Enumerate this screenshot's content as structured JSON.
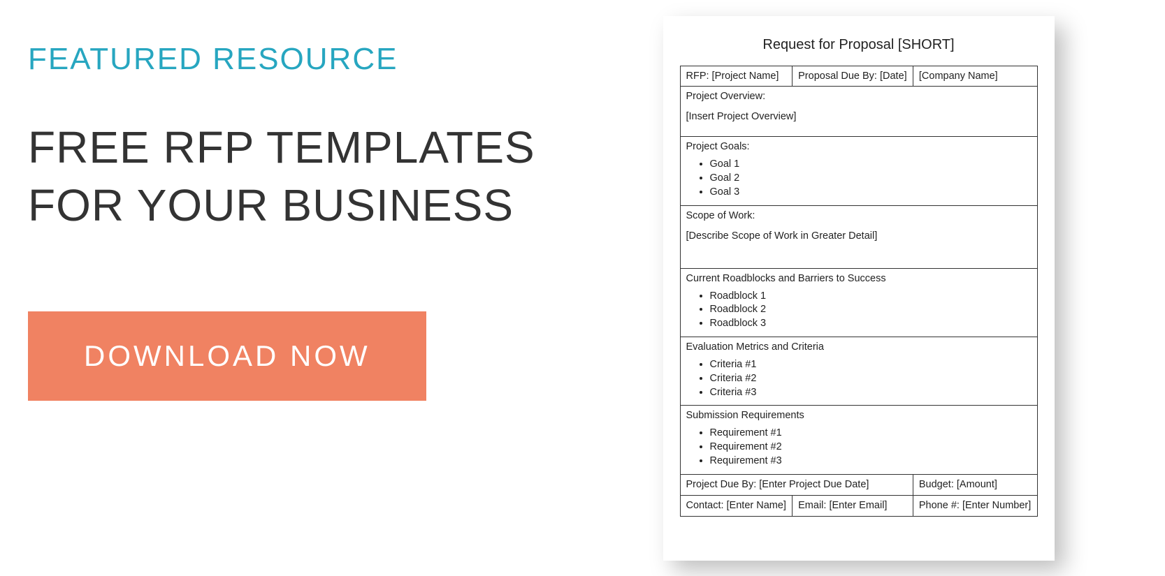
{
  "left": {
    "eyebrow": "FEATURED RESOURCE",
    "headline": "FREE RFP TEMPLATES FOR YOUR BUSINESS",
    "cta": "DOWNLOAD NOW"
  },
  "doc": {
    "title": "Request for Proposal [SHORT]",
    "row1": {
      "rfp": "RFP: [Project Name]",
      "due": "Proposal Due By: [Date]",
      "company": "[Company Name]"
    },
    "overview": {
      "label": "Project Overview:",
      "body": "[Insert Project Overview]"
    },
    "goals": {
      "label": "Project Goals:",
      "items": [
        "Goal 1",
        "Goal 2",
        "Goal 3"
      ]
    },
    "scope": {
      "label": "Scope of Work:",
      "body": "[Describe Scope of Work in Greater Detail]"
    },
    "roadblocks": {
      "label": "Current Roadblocks and Barriers to Success",
      "items": [
        "Roadblock 1",
        "Roadblock 2",
        "Roadblock 3"
      ]
    },
    "criteria": {
      "label": "Evaluation Metrics and Criteria",
      "items": [
        "Criteria #1",
        "Criteria #2",
        "Criteria #3"
      ]
    },
    "submission": {
      "label": "Submission Requirements",
      "items": [
        "Requirement #1",
        "Requirement #2",
        "Requirement #3"
      ]
    },
    "row_due_budget": {
      "due": "Project Due By: [Enter Project Due Date]",
      "budget": "Budget: [Amount]"
    },
    "row_contact": {
      "contact": "Contact: [Enter Name]",
      "email": "Email: [Enter Email]",
      "phone": "Phone #: [Enter Number]"
    }
  }
}
